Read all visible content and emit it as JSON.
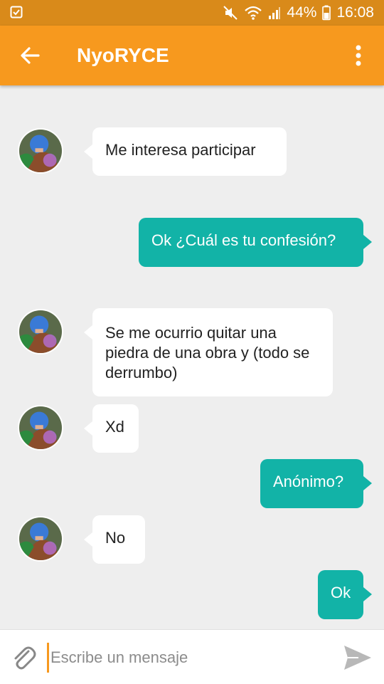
{
  "status": {
    "battery": "44%",
    "time": "16:08"
  },
  "header": {
    "title": "NyoRYCE"
  },
  "messages": [
    {
      "side": "in",
      "text": "Me interesa participar"
    },
    {
      "side": "out",
      "text": "Ok ¿Cuál es tu confesión?"
    },
    {
      "side": "in",
      "text": "Se me ocurrio quitar una piedra de una obra y (todo se derrumbo)"
    },
    {
      "side": "in",
      "text": "Xd"
    },
    {
      "side": "out",
      "text": "Anónimo?"
    },
    {
      "side": "in",
      "text": "No"
    },
    {
      "side": "out",
      "text": "Ok"
    }
  ],
  "composer": {
    "placeholder": "Escribe un mensaje"
  },
  "colors": {
    "statusbar": "#d98a1a",
    "appbar": "#f7991e",
    "outgoing": "#12b3a7",
    "background": "#eeeeee"
  }
}
